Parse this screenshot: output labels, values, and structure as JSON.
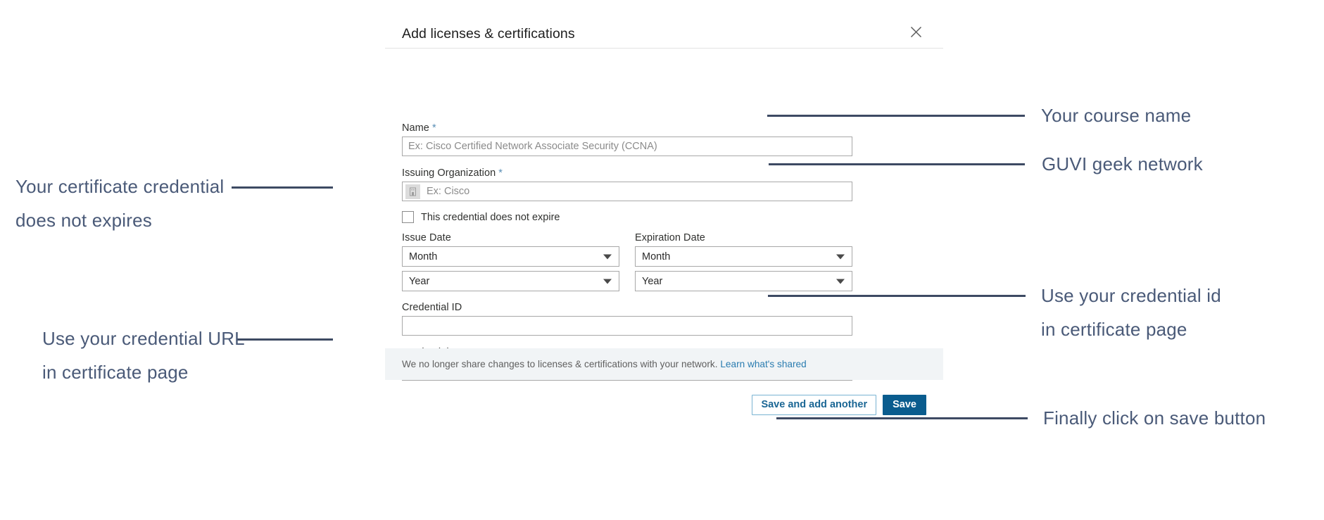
{
  "modal": {
    "title": "Add licenses & certifications",
    "close_icon": "close-icon",
    "fields": {
      "name": {
        "label": "Name",
        "required_marker": "*",
        "placeholder": "Ex: Cisco Certified Network Associate Security (CCNA)",
        "value": ""
      },
      "issuing_organization": {
        "label": "Issuing Organization",
        "required_marker": "*",
        "placeholder": "Ex: Cisco",
        "value": "",
        "icon": "company-building-icon"
      },
      "no_expire_checkbox": {
        "label": "This credential does not expire",
        "checked": false
      },
      "issue_date": {
        "label": "Issue Date",
        "month_value": "Month",
        "year_value": "Year"
      },
      "expiration_date": {
        "label": "Expiration Date",
        "month_value": "Month",
        "year_value": "Year"
      },
      "credential_id": {
        "label": "Credential ID",
        "value": ""
      },
      "credential_url": {
        "label": "Credential URL",
        "value": ""
      }
    },
    "notice": {
      "text": "We no longer share changes to licenses & certifications with your network.",
      "link_text": "Learn what's shared"
    },
    "footer": {
      "save_and_add_another_label": "Save and add another",
      "save_label": "Save"
    }
  },
  "annotations": {
    "course_name": "Your course name",
    "guvi_geek_network": "GUVI geek network",
    "certificate_expire_line1": "Your certificate credential",
    "certificate_expire_line2": "does not expires",
    "credential_id_line1": "Use your credential id",
    "credential_id_line2": "in certificate page",
    "credential_url_line1": "Use your credential URL",
    "credential_url_line2": "in certificate page",
    "save_button": "Finally click on save button"
  },
  "colors": {
    "primary_button": "#0a5c8e",
    "secondary_button_text": "#1a6694",
    "link": "#2a7cb0",
    "annotation_text": "#4a5a78",
    "annotation_line": "#3d4a63",
    "required_marker": "#5a8fb5",
    "notice_background": "#f1f4f6"
  }
}
